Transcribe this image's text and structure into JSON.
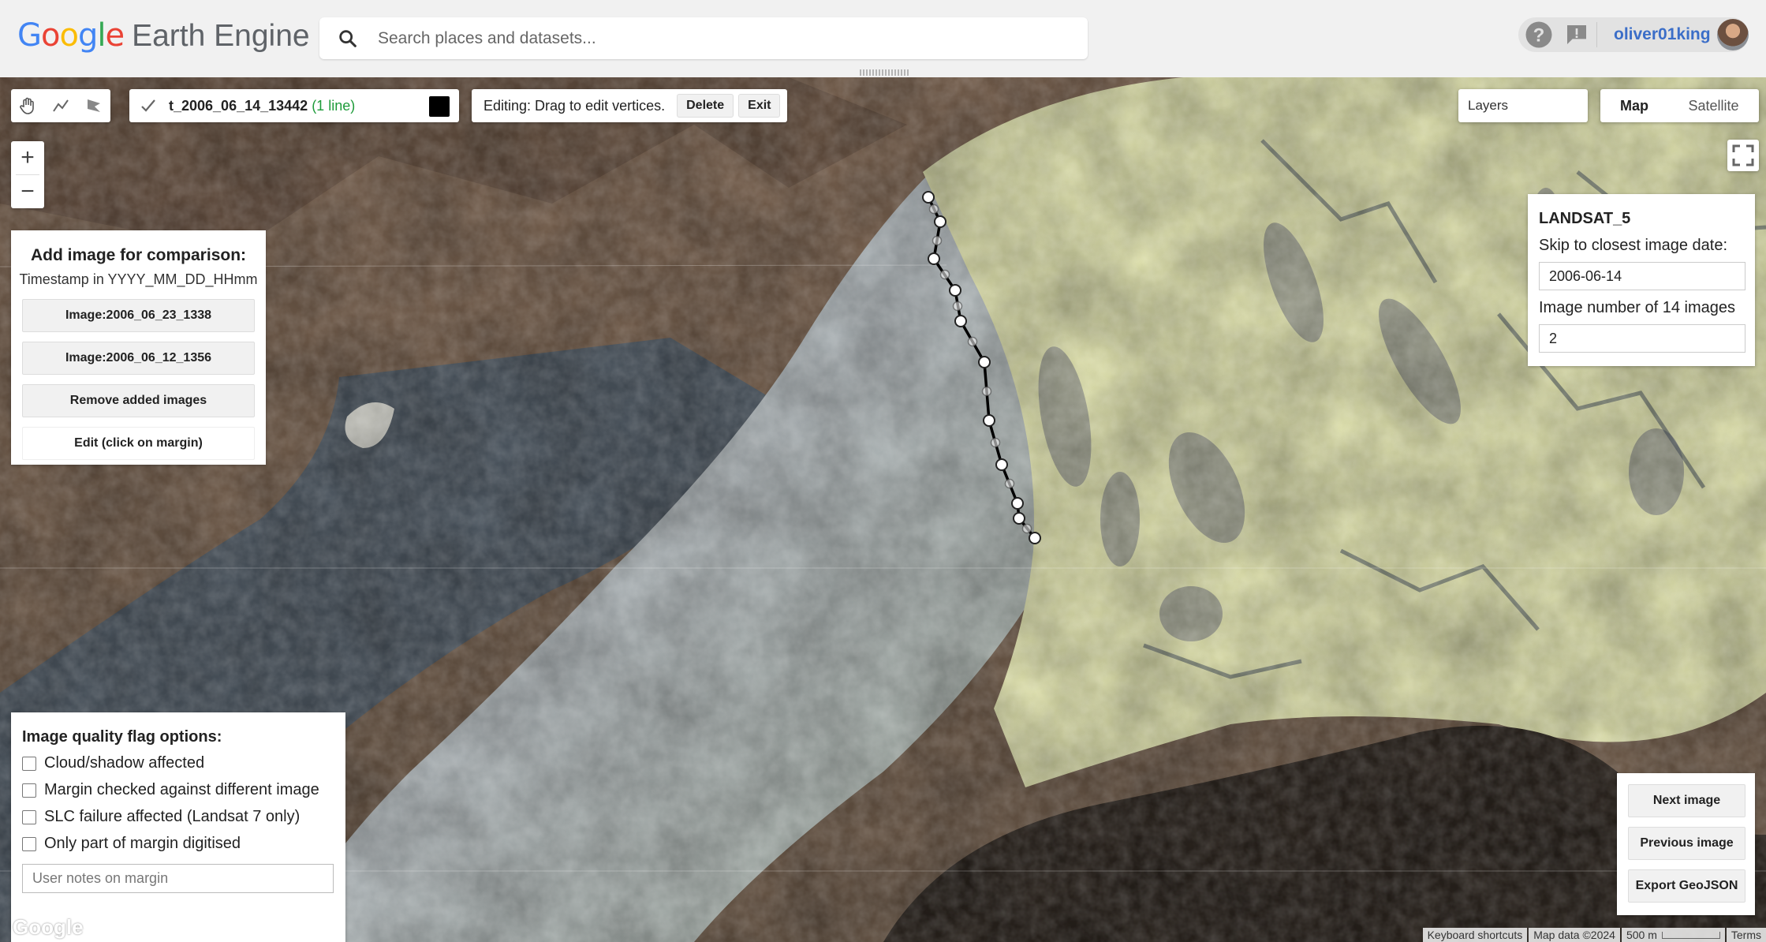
{
  "app": {
    "logo_google": [
      {
        "ch": "G",
        "color": "#4285F4"
      },
      {
        "ch": "o",
        "color": "#EA4335"
      },
      {
        "ch": "o",
        "color": "#FBBC05"
      },
      {
        "ch": "g",
        "color": "#4285F4"
      },
      {
        "ch": "l",
        "color": "#34A853"
      },
      {
        "ch": "e",
        "color": "#EA4335"
      }
    ],
    "logo_product": "Earth Engine",
    "search_placeholder": "Search places and datasets...",
    "username": "oliver01king"
  },
  "icons": {
    "search": "search-icon",
    "help": "help-icon",
    "feedback": "feedback-icon",
    "hand": "hand-pan-icon",
    "line": "draw-line-icon",
    "polygon": "draw-polygon-icon",
    "checkbox": "checkbox-checked-icon",
    "fullscreen": "fullscreen-icon"
  },
  "map_toolbar": {
    "layer_name": "t_2006_06_14_13442",
    "layer_count": "(1 line)",
    "layer_color": "#000000",
    "edit_text": "Editing: Drag to edit vertices.",
    "delete_label": "Delete",
    "exit_label": "Exit",
    "layers_label": "Layers",
    "map_label": "Map",
    "satellite_label": "Satellite",
    "zoom_in": "+",
    "zoom_out": "−"
  },
  "compare_panel": {
    "title": "Add image for comparison:",
    "subtitle": "Timestamp in YYYY_MM_DD_HHmm",
    "buttons": [
      "Image:2006_06_23_1338",
      "Image:2006_06_12_1356",
      "Remove added images"
    ],
    "edit_label": "Edit (click on margin)"
  },
  "landsat_panel": {
    "title": "LANDSAT_5",
    "date_label": "Skip to closest image date:",
    "date_value": "2006-06-14",
    "number_label": "Image number of 14 images",
    "number_value": "2"
  },
  "quality_panel": {
    "title": "Image quality flag options:",
    "options": [
      {
        "label": "Cloud/shadow affected",
        "checked": false
      },
      {
        "label": "Margin checked against different image",
        "checked": false
      },
      {
        "label": "SLC failure affected (Landsat 7 only)",
        "checked": false
      },
      {
        "label": "Only part of margin digitised",
        "checked": false
      }
    ],
    "notes_placeholder": "User notes on margin"
  },
  "nav_panel": {
    "next": "Next image",
    "previous": "Previous image",
    "export": "Export GeoJSON"
  },
  "attribution": {
    "google": "Google",
    "shortcuts": "Keyboard shortcuts",
    "map_data": "Map data ©2024",
    "scale": "500 m",
    "terms": "Terms"
  }
}
